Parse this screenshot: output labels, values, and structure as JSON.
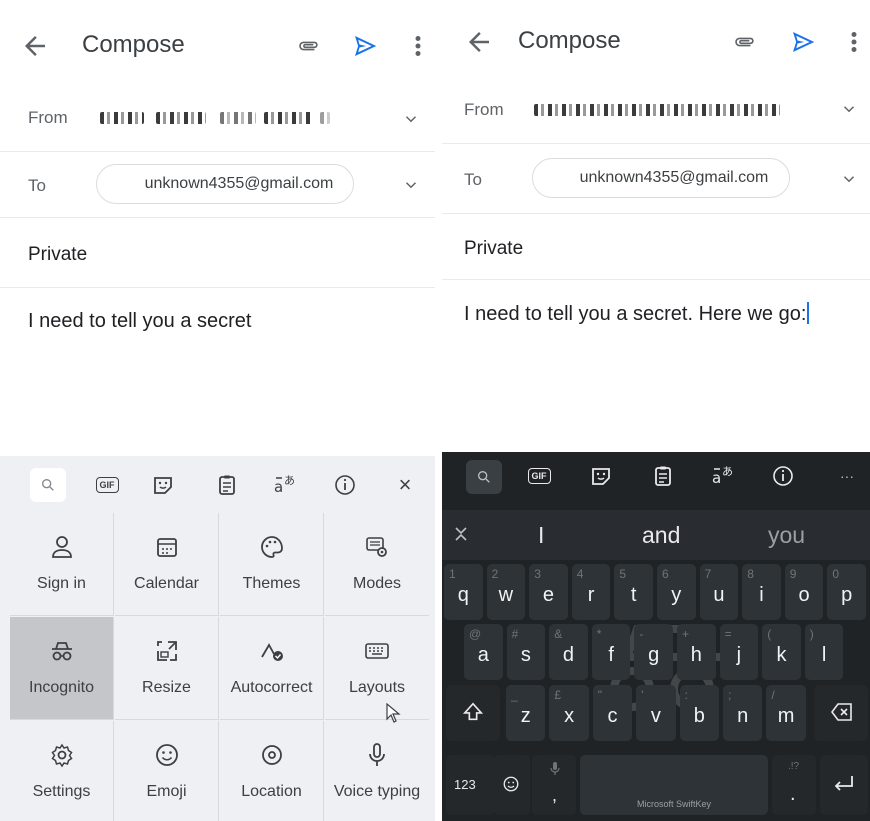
{
  "left": {
    "header": {
      "title": "Compose"
    },
    "from_label": "From",
    "to_label": "To",
    "to_value": "unknown4355@gmail.com",
    "subject": "Private",
    "body": "I need to tell you a secret",
    "menu": {
      "items": [
        {
          "label": "Sign in",
          "icon": "person-icon"
        },
        {
          "label": "Calendar",
          "icon": "calendar-icon"
        },
        {
          "label": "Themes",
          "icon": "palette-icon"
        },
        {
          "label": "Modes",
          "icon": "modes-icon"
        },
        {
          "label": "Incognito",
          "icon": "incognito-icon"
        },
        {
          "label": "Resize",
          "icon": "resize-icon"
        },
        {
          "label": "Autocorrect",
          "icon": "autocorrect-icon"
        },
        {
          "label": "Layouts",
          "icon": "keyboard-icon"
        },
        {
          "label": "Settings",
          "icon": "gear-icon"
        },
        {
          "label": "Emoji",
          "icon": "smiley-icon"
        },
        {
          "label": "Location",
          "icon": "location-icon"
        },
        {
          "label": "Voice typing",
          "icon": "microphone-icon"
        }
      ]
    }
  },
  "right": {
    "header": {
      "title": "Compose"
    },
    "from_label": "From",
    "to_label": "To",
    "to_value": "unknown4355@gmail.com",
    "subject": "Private",
    "body": "I need to tell you a secret. Here we go:",
    "suggestions": [
      "I",
      "and",
      "you"
    ],
    "keyboard": {
      "row1": [
        [
          "q",
          "1"
        ],
        [
          "w",
          "2"
        ],
        [
          "e",
          "3"
        ],
        [
          "r",
          "4"
        ],
        [
          "t",
          "5"
        ],
        [
          "y",
          "6"
        ],
        [
          "u",
          "7"
        ],
        [
          "i",
          "8"
        ],
        [
          "o",
          "9"
        ],
        [
          "p",
          "0"
        ]
      ],
      "row2": [
        [
          "a",
          "@"
        ],
        [
          "s",
          "#"
        ],
        [
          "d",
          "&"
        ],
        [
          "f",
          "*"
        ],
        [
          "g",
          "-"
        ],
        [
          "h",
          "+"
        ],
        [
          "j",
          "="
        ],
        [
          "k",
          "("
        ],
        [
          "l",
          ")"
        ]
      ],
      "row3": [
        [
          "z",
          "_"
        ],
        [
          "x",
          "£"
        ],
        [
          "c",
          "\""
        ],
        [
          "v",
          "'"
        ],
        [
          "b",
          ":"
        ],
        [
          "n",
          ";"
        ],
        [
          "m",
          "/"
        ]
      ],
      "numbers_key": "123",
      "comma_key": ",",
      "period_key": ".",
      "period_hint": ".!?",
      "space_label": "Microsoft SwiftKey",
      "more_label": "···"
    }
  },
  "gif_label": "GIF",
  "close_label": "×",
  "colors": {
    "send": "#1a73e8",
    "dark_bg": "#1f2326",
    "menu_bg": "#eef0f3"
  }
}
